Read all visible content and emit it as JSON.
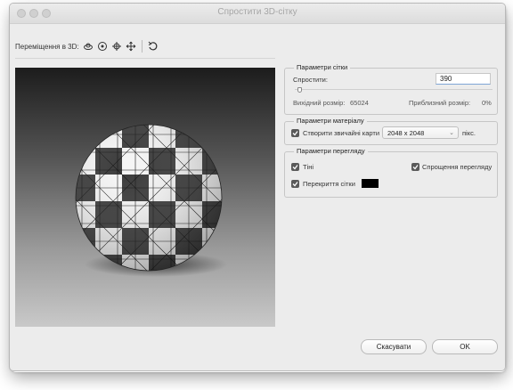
{
  "window": {
    "title": "Спростити 3D-сітку"
  },
  "toolbar": {
    "label": "Переміщення в 3D:",
    "tools": [
      "orbit-3d-icon",
      "roll-3d-icon",
      "pan-3d-icon",
      "slide-3d-icon",
      "reset-view-icon"
    ]
  },
  "mesh_params": {
    "title": "Параметри сітки",
    "simplify_label": "Спростити:",
    "simplify_value": "390",
    "slider_fraction": 0.02,
    "source_size_label": "Вихідний розмір:",
    "source_size_value": "65024",
    "approx_size_label": "Приблизний розмір:",
    "approx_size_value": "0%"
  },
  "material_params": {
    "title": "Параметри матеріалу",
    "create_maps_label": "Створити звичайні карти",
    "create_maps_checked": true,
    "map_size_value": "2048 x 2048",
    "unit_label": "пікс."
  },
  "view_params": {
    "title": "Параметри перегляду",
    "shadows_label": "Тіні",
    "shadows_checked": true,
    "simplify_view_label": "Спрощення перегляду",
    "simplify_view_checked": true,
    "mesh_overlay_label": "Перекриття сітки",
    "mesh_overlay_checked": true,
    "overlay_color": "#000000"
  },
  "buttons": {
    "cancel": "Скасувати",
    "ok": "OK"
  }
}
